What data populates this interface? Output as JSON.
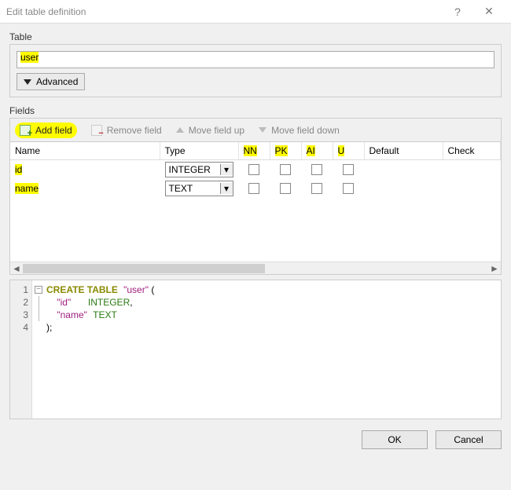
{
  "window": {
    "title": "Edit table definition"
  },
  "table_section": {
    "label": "Table",
    "value": "user",
    "advanced": "Advanced"
  },
  "fields_section": {
    "label": "Fields",
    "toolbar": {
      "add": "Add field",
      "remove": "Remove field",
      "up": "Move field up",
      "down": "Move field down"
    },
    "columns": {
      "name": "Name",
      "type": "Type",
      "nn": "NN",
      "pk": "PK",
      "ai": "AI",
      "u": "U",
      "default": "Default",
      "check": "Check"
    },
    "rows": [
      {
        "name": "id",
        "type": "INTEGER",
        "nn": false,
        "pk": false,
        "ai": false,
        "u": false,
        "default": "",
        "check": ""
      },
      {
        "name": "name",
        "type": "TEXT",
        "nn": false,
        "pk": false,
        "ai": false,
        "u": false,
        "default": "",
        "check": ""
      }
    ]
  },
  "sql": {
    "ln1": "1",
    "ln2": "2",
    "ln3": "3",
    "ln4": "4",
    "kw_create": "CREATE TABLE",
    "tbl_name": "\"user\"",
    "open_paren": " (",
    "indent": "    ",
    "col_id": "\"id\"",
    "type_int": "INTEGER",
    "comma": ",",
    "col_name": "\"name\"",
    "type_text": "TEXT",
    "close": ");"
  },
  "buttons": {
    "ok": "OK",
    "cancel": "Cancel"
  }
}
